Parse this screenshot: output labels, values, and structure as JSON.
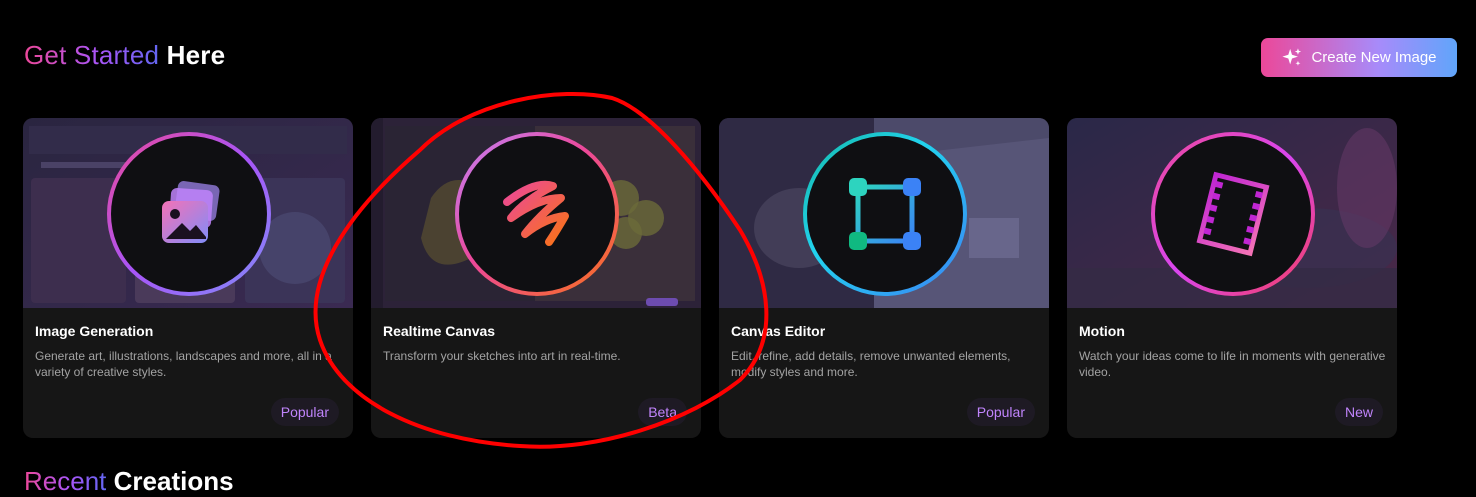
{
  "header": {
    "title_part1": "Get Started",
    "title_part2": "Here",
    "create_button_label": "Create New Image",
    "create_button_icon": "sparkles-icon"
  },
  "cards": [
    {
      "title": "Image Generation",
      "description": "Generate art, illustrations, landscapes and more, all in a variety of creative styles.",
      "badge": "Popular",
      "icon": "image-stack-icon",
      "ring_colors": [
        "#ec4899",
        "#818cf8"
      ]
    },
    {
      "title": "Realtime Canvas",
      "description": "Transform your sketches into art in real-time.",
      "badge": "Beta",
      "icon": "scribble-icon",
      "ring_colors": [
        "#ec4899",
        "#f97316"
      ]
    },
    {
      "title": "Canvas Editor",
      "description": "Edit, refine, add details, remove unwanted elements, modify styles and more.",
      "badge": "Popular",
      "icon": "bounding-box-icon",
      "ring_colors": [
        "#14b8a6",
        "#3b82f6"
      ]
    },
    {
      "title": "Motion",
      "description": "Watch your ideas come to life in moments with generative video.",
      "badge": "New",
      "icon": "film-strip-icon",
      "ring_colors": [
        "#c026d3",
        "#ec4899"
      ]
    }
  ],
  "recent": {
    "title_part1": "Recent",
    "title_part2": "Creations"
  },
  "annotation": {
    "color": "#ff0000",
    "shape": "freehand-circle"
  }
}
